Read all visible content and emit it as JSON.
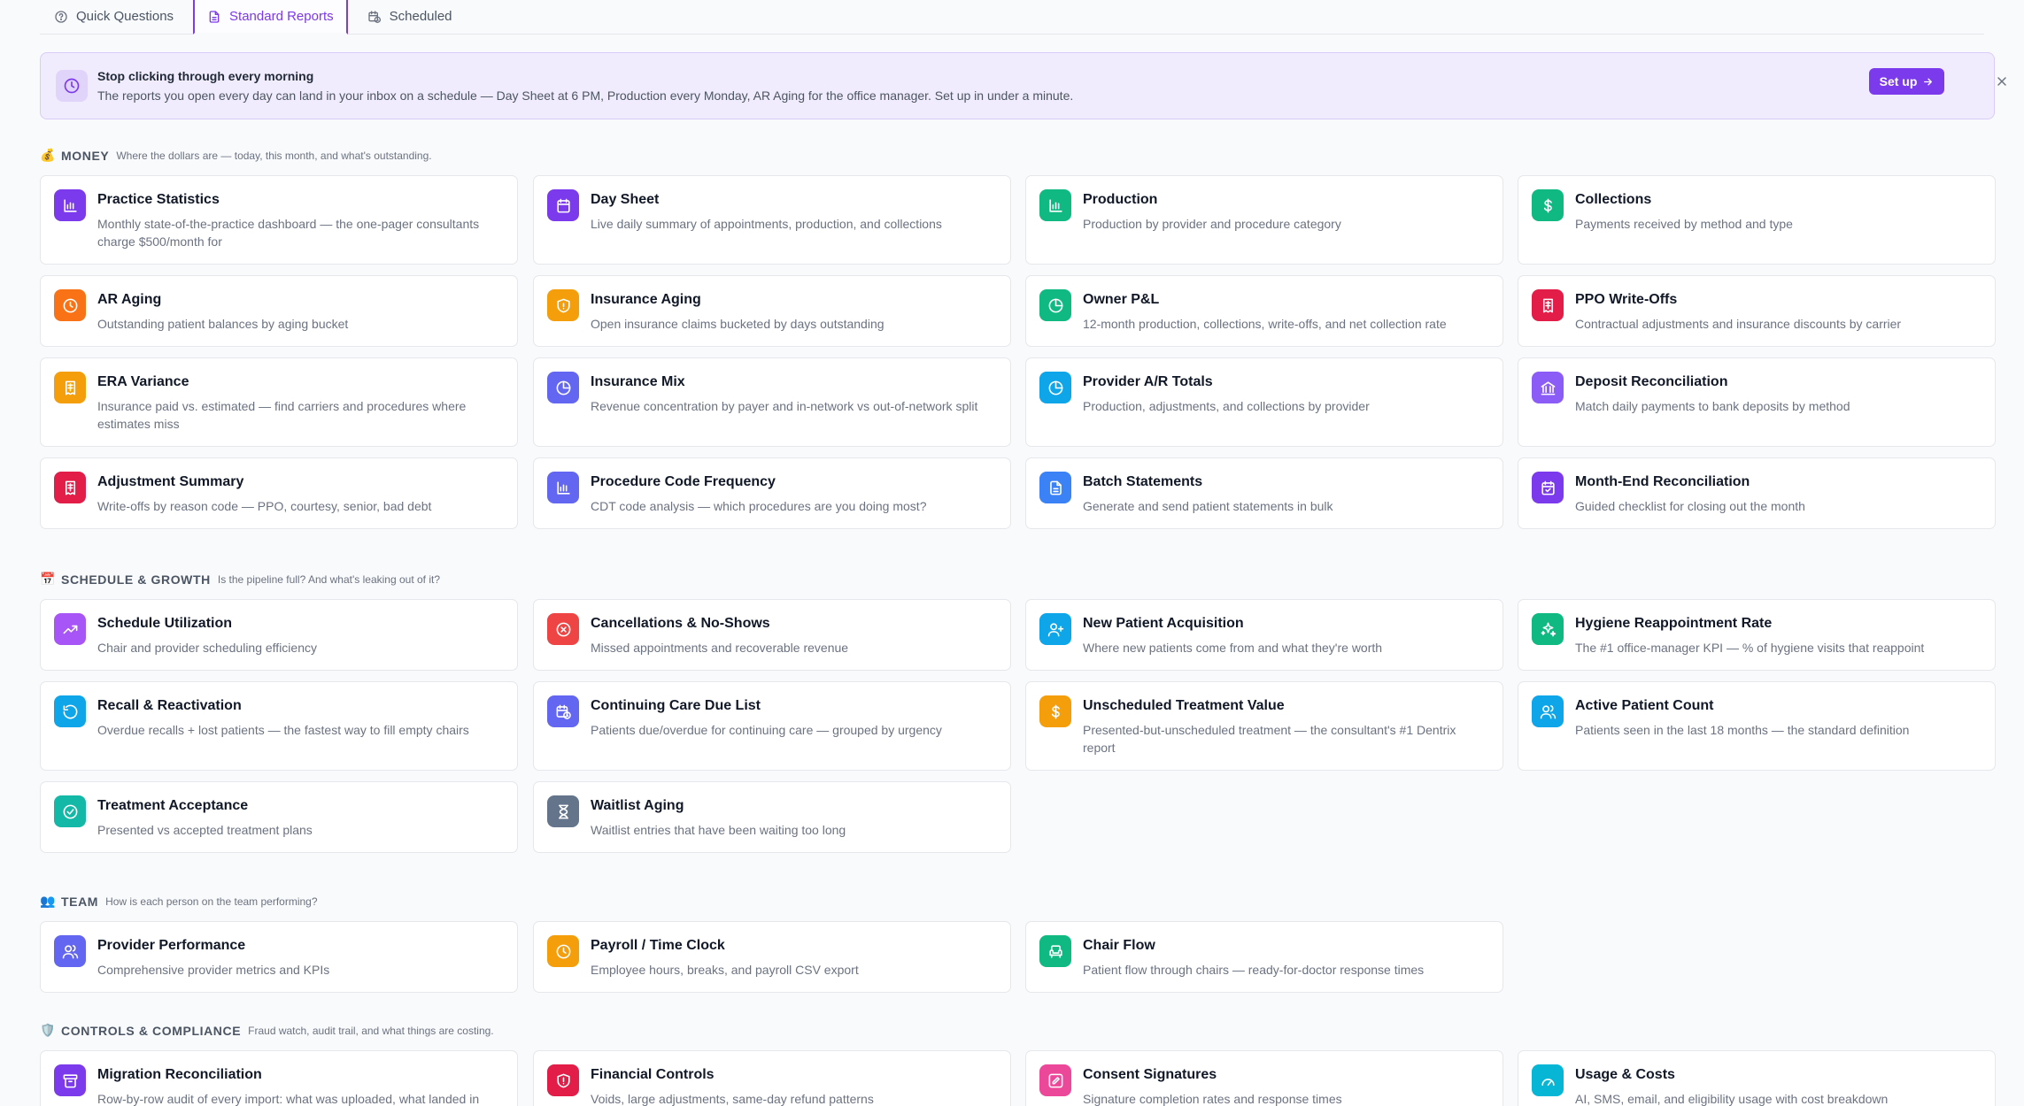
{
  "tabs": [
    {
      "label": "Quick Questions",
      "icon": "chat-bubble-icon",
      "active": false
    },
    {
      "label": "Standard Reports",
      "icon": "document-icon",
      "active": true
    },
    {
      "label": "Scheduled",
      "icon": "calendar-clock-icon",
      "active": false
    }
  ],
  "banner": {
    "title": "Stop clicking through every morning",
    "text": "The reports you open every day can land in your inbox on a schedule — Day Sheet at 6 PM, Production every Monday, AR Aging for the office manager. Set up in under a minute.",
    "button_label": "Set up",
    "accent": "#7c3aed"
  },
  "sections": [
    {
      "emoji": "💰",
      "title": "Money",
      "desc": "Where the dollars are — today, this month, and what's outstanding.",
      "cards": [
        {
          "title": "Practice Statistics",
          "desc": "Monthly state-of-the-practice dashboard — the one-pager consultants charge $500/month for",
          "icon": "bar-chart-icon",
          "color": "#7c3aed"
        },
        {
          "title": "Day Sheet",
          "desc": "Live daily summary of appointments, production, and collections",
          "icon": "calendar-icon",
          "color": "#7c3aed"
        },
        {
          "title": "Production",
          "desc": "Production by provider and procedure category",
          "icon": "bar-chart-icon",
          "color": "#10b981"
        },
        {
          "title": "Collections",
          "desc": "Payments received by method and type",
          "icon": "dollar-icon",
          "color": "#10b981"
        },
        {
          "title": "AR Aging",
          "desc": "Outstanding patient balances by aging bucket",
          "icon": "clock-icon",
          "color": "#f97316"
        },
        {
          "title": "Insurance Aging",
          "desc": "Open insurance claims bucketed by days outstanding",
          "icon": "shield-icon",
          "color": "#f59e0b"
        },
        {
          "title": "Owner P&L",
          "desc": "12-month production, collections, write-offs, and net collection rate",
          "icon": "pie-chart-icon",
          "color": "#10b981"
        },
        {
          "title": "PPO Write-Offs",
          "desc": "Contractual adjustments and insurance discounts by carrier",
          "icon": "receipt-icon",
          "color": "#e11d48"
        },
        {
          "title": "ERA Variance",
          "desc": "Insurance paid vs. estimated — find carriers and procedures where estimates miss",
          "icon": "receipt-icon",
          "color": "#f59e0b"
        },
        {
          "title": "Insurance Mix",
          "desc": "Revenue concentration by payer and in-network vs out-of-network split",
          "icon": "pie-chart-icon",
          "color": "#6366f1"
        },
        {
          "title": "Provider A/R Totals",
          "desc": "Production, adjustments, and collections by provider",
          "icon": "pie-chart-icon",
          "color": "#0ea5e9"
        },
        {
          "title": "Deposit Reconciliation",
          "desc": "Match daily payments to bank deposits by method",
          "icon": "bank-icon",
          "color": "#8b5cf6"
        },
        {
          "title": "Adjustment Summary",
          "desc": "Write-offs by reason code — PPO, courtesy, senior, bad debt",
          "icon": "receipt-icon",
          "color": "#e11d48"
        },
        {
          "title": "Procedure Code Frequency",
          "desc": "CDT code analysis — which procedures are you doing most?",
          "icon": "bar-chart-icon",
          "color": "#6366f1"
        },
        {
          "title": "Batch Statements",
          "desc": "Generate and send patient statements in bulk",
          "icon": "document-icon",
          "color": "#3b82f6"
        },
        {
          "title": "Month-End Reconciliation",
          "desc": "Guided checklist for closing out the month",
          "icon": "calendar-check-icon",
          "color": "#7c3aed"
        }
      ]
    },
    {
      "emoji": "📅",
      "title": "Schedule & Growth",
      "desc": "Is the pipeline full? And what's leaking out of it?",
      "cards": [
        {
          "title": "Schedule Utilization",
          "desc": "Chair and provider scheduling efficiency",
          "icon": "trending-up-icon",
          "color": "#a855f7"
        },
        {
          "title": "Cancellations & No-Shows",
          "desc": "Missed appointments and recoverable revenue",
          "icon": "x-circle-icon",
          "color": "#ef4444"
        },
        {
          "title": "New Patient Acquisition",
          "desc": "Where new patients come from and what they're worth",
          "icon": "user-plus-icon",
          "color": "#0ea5e9"
        },
        {
          "title": "Hygiene Reappointment Rate",
          "desc": "The #1 office-manager KPI — % of hygiene visits that reappoint",
          "icon": "sparkles-icon",
          "color": "#10b981"
        },
        {
          "title": "Recall & Reactivation",
          "desc": "Overdue recalls + lost patients — the fastest way to fill empty chairs",
          "icon": "refresh-icon",
          "color": "#0ea5e9"
        },
        {
          "title": "Continuing Care Due List",
          "desc": "Patients due/overdue for continuing care — grouped by urgency",
          "icon": "calendar-clock-icon",
          "color": "#6366f1"
        },
        {
          "title": "Unscheduled Treatment Value",
          "desc": "Presented-but-unscheduled treatment — the consultant's #1 Dentrix report",
          "icon": "dollar-icon",
          "color": "#f59e0b"
        },
        {
          "title": "Active Patient Count",
          "desc": "Patients seen in the last 18 months — the standard definition",
          "icon": "users-icon",
          "color": "#0ea5e9"
        },
        {
          "title": "Treatment Acceptance",
          "desc": "Presented vs accepted treatment plans",
          "icon": "check-circle-icon",
          "color": "#14b8a6"
        },
        {
          "title": "Waitlist Aging",
          "desc": "Waitlist entries that have been waiting too long",
          "icon": "hourglass-icon",
          "color": "#64748b"
        }
      ]
    },
    {
      "emoji": "👥",
      "title": "Team",
      "desc": "How is each person on the team performing?",
      "cards": [
        {
          "title": "Provider Performance",
          "desc": "Comprehensive provider metrics and KPIs",
          "icon": "users-icon",
          "color": "#6366f1"
        },
        {
          "title": "Payroll / Time Clock",
          "desc": "Employee hours, breaks, and payroll CSV export",
          "icon": "clock-icon",
          "color": "#f59e0b"
        },
        {
          "title": "Chair Flow",
          "desc": "Patient flow through chairs — ready-for-doctor response times",
          "icon": "chair-icon",
          "color": "#10b981"
        }
      ]
    },
    {
      "emoji": "🛡️",
      "title": "Controls & Compliance",
      "desc": "Fraud watch, audit trail, and what things are costing.",
      "cards": [
        {
          "title": "Migration Reconciliation",
          "desc": "Row-by-row audit of every import: what was uploaded, what landed in",
          "icon": "archive-icon",
          "color": "#7c3aed"
        },
        {
          "title": "Financial Controls",
          "desc": "Voids, large adjustments, same-day refund patterns",
          "icon": "shield-alert-icon",
          "color": "#e11d48"
        },
        {
          "title": "Consent Signatures",
          "desc": "Signature completion rates and response times",
          "icon": "pen-square-icon",
          "color": "#ec4899"
        },
        {
          "title": "Usage & Costs",
          "desc": "AI, SMS, email, and eligibility usage with cost breakdown",
          "icon": "gauge-icon",
          "color": "#06b6d4"
        }
      ]
    }
  ]
}
